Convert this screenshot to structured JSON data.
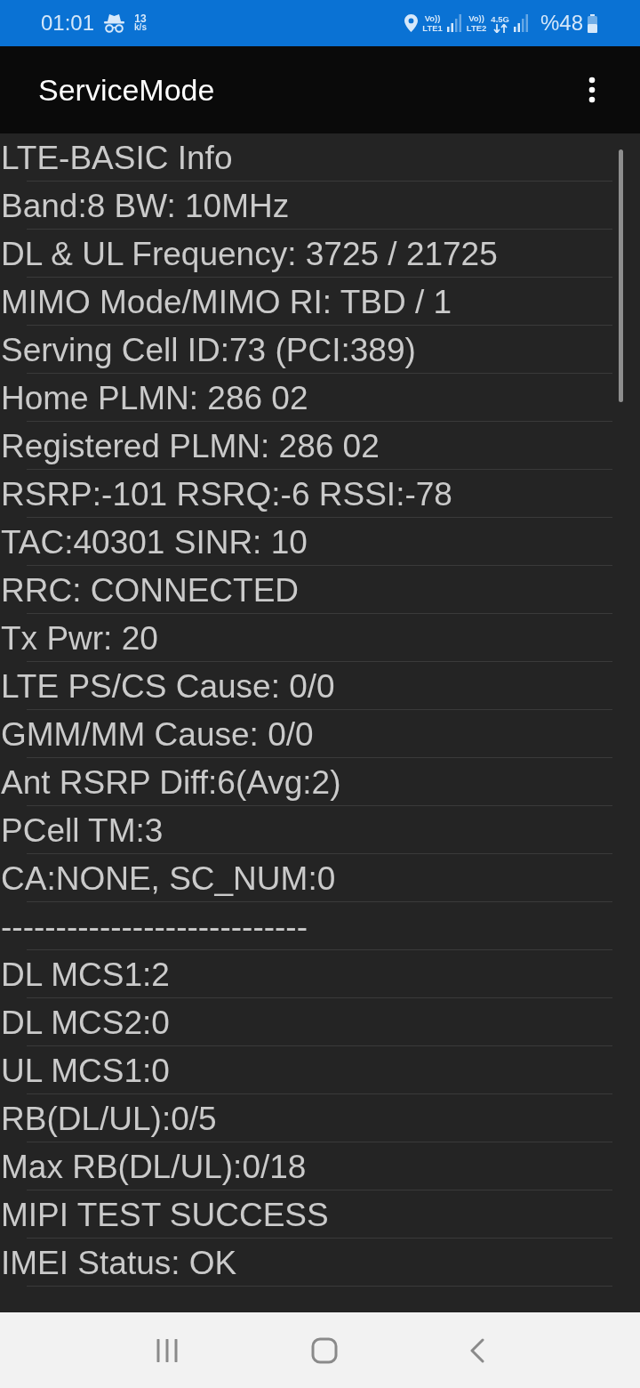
{
  "status_bar": {
    "time": "01:01",
    "net_speed": {
      "value": "13",
      "unit": "k/s"
    },
    "sims": [
      {
        "volte": "Vo))",
        "label": "LTE1"
      },
      {
        "volte": "Vo))",
        "label": "LTE2",
        "network": "4.5G"
      }
    ],
    "battery": "%48"
  },
  "app_bar": {
    "title": "ServiceMode"
  },
  "info_lines": [
    "LTE-BASIC Info",
    "Band:8 BW: 10MHz",
    "DL & UL Frequency: 3725 / 21725",
    "MIMO Mode/MIMO RI: TBD / 1",
    "Serving Cell ID:73 (PCI:389)",
    "Home PLMN: 286 02",
    "Registered PLMN: 286 02",
    "RSRP:-101 RSRQ:-6 RSSI:-78",
    "TAC:40301 SINR: 10",
    "RRC: CONNECTED",
    "Tx Pwr: 20",
    "LTE PS/CS Cause: 0/0",
    "GMM/MM Cause: 0/0",
    "Ant RSRP Diff:6(Avg:2)",
    "PCell TM:3",
    "CA:NONE, SC_NUM:0",
    "----------------------------",
    "DL MCS1:2",
    "DL MCS2:0",
    "UL MCS1:0",
    "RB(DL/UL):0/5",
    "Max RB(DL/UL):0/18",
    "MIPI TEST SUCCESS",
    "IMEI Status: OK"
  ]
}
